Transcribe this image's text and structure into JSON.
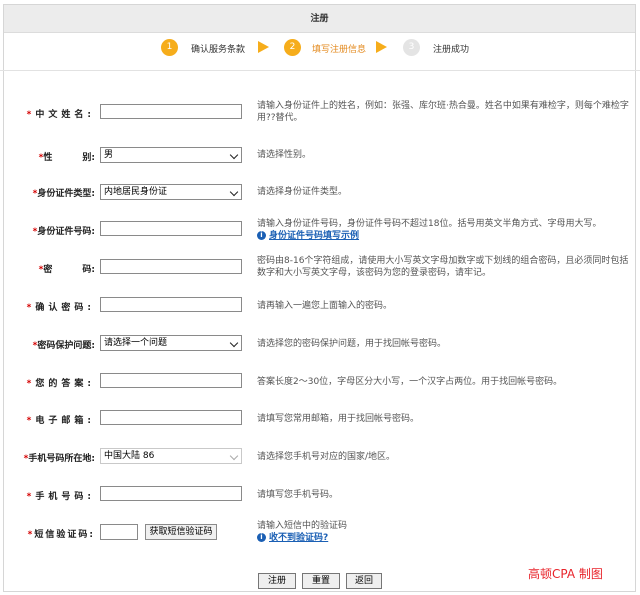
{
  "header": {
    "title": "注册"
  },
  "steps": [
    {
      "num": "1",
      "label": "确认服务条款",
      "state": "done"
    },
    {
      "num": "2",
      "label": "填写注册信息",
      "state": "current"
    },
    {
      "num": "3",
      "label": "注册成功",
      "state": "pending"
    }
  ],
  "colors": {
    "accent": "#f6ad1b",
    "required": "#d40000",
    "link": "#1a5fb4",
    "watermark": "#e8232a"
  },
  "form": {
    "required_mark": "*",
    "name": {
      "label": "中文姓名:",
      "value": "",
      "hint": "请输入身份证件上的姓名，例如：张强、库尔班·热合曼。姓名中如果有难检字，则每个难检字用??替代。"
    },
    "gender": {
      "label_a": "性",
      "label_b": "别:",
      "value": "男",
      "hint": "请选择性别。"
    },
    "id_type": {
      "label": "身份证件类型:",
      "value": "内地居民身份证",
      "hint": "请选择身份证件类型。"
    },
    "id_number": {
      "label": "身份证件号码:",
      "value": "",
      "hint": "请输入身份证件号码，身份证件号码不超过18位。括号用英文半角方式、字母用大写。",
      "link": "身份证件号码填写示例",
      "link_icon": "info-icon"
    },
    "password": {
      "label_a": "密",
      "label_b": "码:",
      "value": "",
      "hint": "密码由8-16个字符组成，请使用大小写英文字母加数字或下划线的组合密码，且必须同时包括数字和大小写英文字母，该密码为您的登录密码，请牢记。"
    },
    "confirm": {
      "label": "确认密码:",
      "value": "",
      "hint": "请再输入一遍您上面输入的密码。"
    },
    "question": {
      "label": "密码保护问题:",
      "value": "请选择一个问题",
      "hint": "请选择您的密码保护问题，用于找回帐号密码。"
    },
    "answer": {
      "label": "您的答案:",
      "value": "",
      "hint": "答案长度2～30位，字母区分大小写，一个汉字占两位。用于找回帐号密码。"
    },
    "email": {
      "label": "电子邮箱:",
      "value": "",
      "hint": "请填写您常用邮箱，用于找回帐号密码。"
    },
    "region": {
      "label": "手机号码所在地:",
      "value": "中国大陆 86",
      "hint": "请选择您手机号对应的国家/地区。"
    },
    "phone": {
      "label": "手机号码:",
      "value": "",
      "hint": "请填写您手机号码。"
    },
    "sms": {
      "label": "短信验证码:",
      "value": "",
      "button": "获取短信验证码",
      "hint": "请输入短信中的验证码",
      "link": "收不到验证码?",
      "link_icon": "info-icon"
    }
  },
  "actions": {
    "submit": "注册",
    "reset": "重置",
    "back": "返回"
  },
  "watermark": "高顿CPA  制图"
}
